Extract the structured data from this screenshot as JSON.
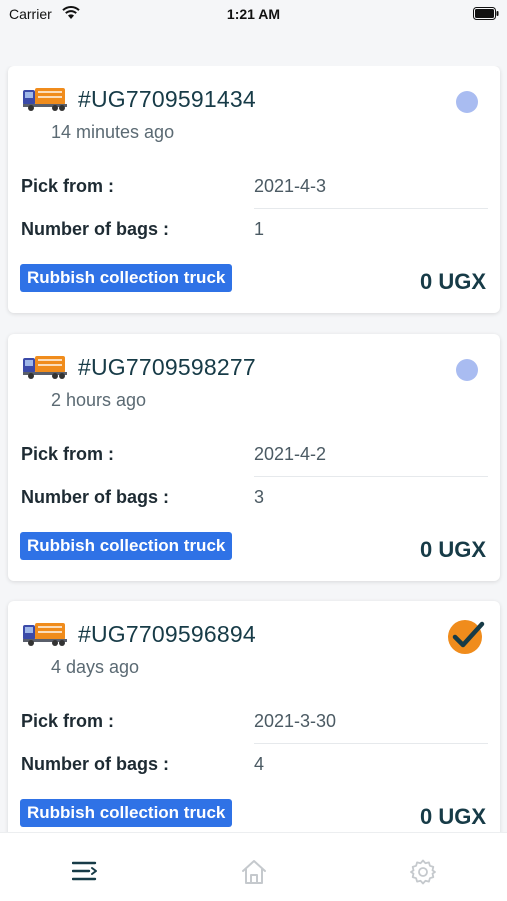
{
  "status_bar": {
    "carrier": "Carrier",
    "time": "1:21 AM"
  },
  "orders": [
    {
      "id": "#UG7709591434",
      "time_ago": "14 minutes ago",
      "pick_from_label": "Pick from :",
      "pick_from_value": "2021-4-3",
      "bags_label": "Number of bags :",
      "bags_value": "1",
      "type": "Rubbish collection truck",
      "price": "0 UGX",
      "status": "pending"
    },
    {
      "id": "#UG7709598277",
      "time_ago": "2 hours ago",
      "pick_from_label": "Pick from :",
      "pick_from_value": "2021-4-2",
      "bags_label": "Number of bags :",
      "bags_value": "3",
      "type": "Rubbish collection truck",
      "price": "0 UGX",
      "status": "pending"
    },
    {
      "id": "#UG7709596894",
      "time_ago": "4 days ago",
      "pick_from_label": "Pick from :",
      "pick_from_value": "2021-3-30",
      "bags_label": "Number of bags :",
      "bags_value": "4",
      "type": "Rubbish collection truck",
      "price": "0 UGX",
      "status": "completed"
    }
  ],
  "tab_bar": {
    "tabs": [
      {
        "icon": "list-icon",
        "active": true
      },
      {
        "icon": "home-icon",
        "active": false
      },
      {
        "icon": "gear-icon",
        "active": false
      }
    ]
  },
  "colors": {
    "badge": "#2f72e6",
    "pending_dot": "#a9bcf1",
    "completed": "#f08c1c",
    "tab_active": "#173b47",
    "tab_inactive": "#c5c9cd"
  }
}
